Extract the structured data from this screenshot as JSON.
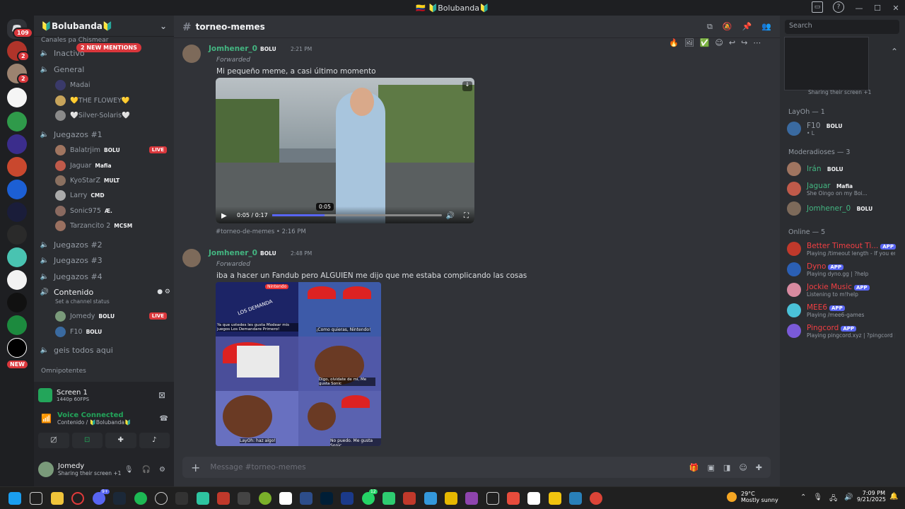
{
  "window": {
    "title": "🇨🇴 🔰Bolubanda🔰"
  },
  "guilds": {
    "badge_top": "109",
    "badge_2": "2",
    "badge_3": "2",
    "new_label": "NEW"
  },
  "server": {
    "name": "🔰Bolubanda🔰",
    "category1": "Canales pa Chismear",
    "mentions": "2 NEW MENTIONS",
    "category2": "Omnipotentes"
  },
  "channels": [
    {
      "name": "Inactivo"
    },
    {
      "name": "General"
    },
    {
      "name": "Juegazos #1"
    },
    {
      "name": "Juegazos #2"
    },
    {
      "name": "Juegazos #3"
    },
    {
      "name": "Juegazos #4"
    },
    {
      "name": "Contenido",
      "status": "Set a channel status"
    },
    {
      "name": "geis todos aqui"
    }
  ],
  "voice_users": {
    "general": [
      {
        "name": "Madai"
      },
      {
        "name": "💛THE FLOWEY💛"
      },
      {
        "name": "🤍Silver-Solaris🤍"
      }
    ],
    "juegazos1": [
      {
        "name": "Balatrjim",
        "tag": "BOLU",
        "live": "LIVE"
      },
      {
        "name": "Jaguar",
        "tag": "Mafia"
      },
      {
        "name": "KyoStarZ",
        "tag": "MULT"
      },
      {
        "name": "Larry",
        "tag": "CMD"
      },
      {
        "name": "Sonic975",
        "tag": "Æ."
      },
      {
        "name": "Tarzancito 2",
        "tag": "MCSM"
      }
    ],
    "contenido": [
      {
        "name": "Jomedy",
        "tag": "BOLU",
        "live": "LIVE"
      },
      {
        "name": "F10",
        "tag": "BOLU"
      }
    ]
  },
  "stream_panel": {
    "title": "Screen 1",
    "sub": "1440p 60FPS"
  },
  "voice_panel": {
    "status": "Voice Connected",
    "location": "Contenido / 🔰Bolubanda🔰"
  },
  "user": {
    "name": "Jomedy",
    "status": "Sharing their screen +1"
  },
  "channel": {
    "name": "torneo-memes",
    "composer_placeholder": "Message #torneo-memes"
  },
  "messages": [
    {
      "author": "Jomhener_0",
      "tag": "BOLU",
      "time": "2:21 PM",
      "forwarded": "Forwarded",
      "text": "Mi pequeño meme, a casi último momento",
      "video_time": "0:05 / 0:17",
      "video_tooltip": "0:05",
      "source": "#torneo-de-memes",
      "source_time": "2:16 PM"
    },
    {
      "author": "Jomhener_0",
      "tag": "BOLU",
      "time": "2:48 PM",
      "forwarded": "Forwarded",
      "text": "iba a hacer un Fandub pero ALGUIEN me dijo que me estaba complicando las cosas",
      "comic": {
        "panel1_caption": "Ya que ustedes les gusta Modear mis juegos Los Demandare Primero!",
        "panel1_banner": "LOS DEMANDA",
        "panel1_logo": "Nintendo",
        "panel2_caption": "¡Como quieras, Nintendo!",
        "panel4_caption": "Digo, olvidate de mi, Me gusta Sonic",
        "panel5_caption": "LayOh: haz algo!",
        "panel6_caption": "No puedo. Me gusta Sonic"
      }
    }
  ],
  "search": {
    "placeholder": "Search"
  },
  "members": {
    "group1_status": "Sharing their screen +1",
    "group_layoh": "LayOh — 1",
    "layoh": [
      {
        "name": "F10",
        "tag": "BOLU",
        "status": "• L"
      }
    ],
    "group_mod": "Moderadioses — 3",
    "mods": [
      {
        "name": "Irán",
        "tag": "BOLU",
        "status": ""
      },
      {
        "name": "Jaguar",
        "tag": "Mafia",
        "status": "She Oingo on my Boi..."
      },
      {
        "name": "Jomhener_0",
        "tag": "BOLU",
        "status": ""
      }
    ],
    "group_online": "Online — 5",
    "online": [
      {
        "name": "Better Timeout Ti...",
        "app": "APP",
        "status": "Playing /timeout length - If you en..."
      },
      {
        "name": "Dyno",
        "app": "APP",
        "status": "Playing dyno.gg | ?help"
      },
      {
        "name": "Jockie Music",
        "app": "APP",
        "status": "Listening to m!help"
      },
      {
        "name": "MEE6",
        "app": "APP",
        "status": "Playing /mee6-games"
      },
      {
        "name": "Pingcord",
        "app": "APP",
        "status": "Playing pingcord.xyz | ?pingcord | ..."
      }
    ]
  },
  "taskbar": {
    "weather_temp": "29°C",
    "weather_desc": "Mostly sunny",
    "time": "7:09 PM",
    "date": "9/21/2025",
    "discord_badge": "9+",
    "whatsapp_badge": "12"
  },
  "colors": {
    "accent": "#5865f2",
    "live": "#da373c",
    "green": "#23a55a",
    "bot_red": "#f23f43"
  }
}
